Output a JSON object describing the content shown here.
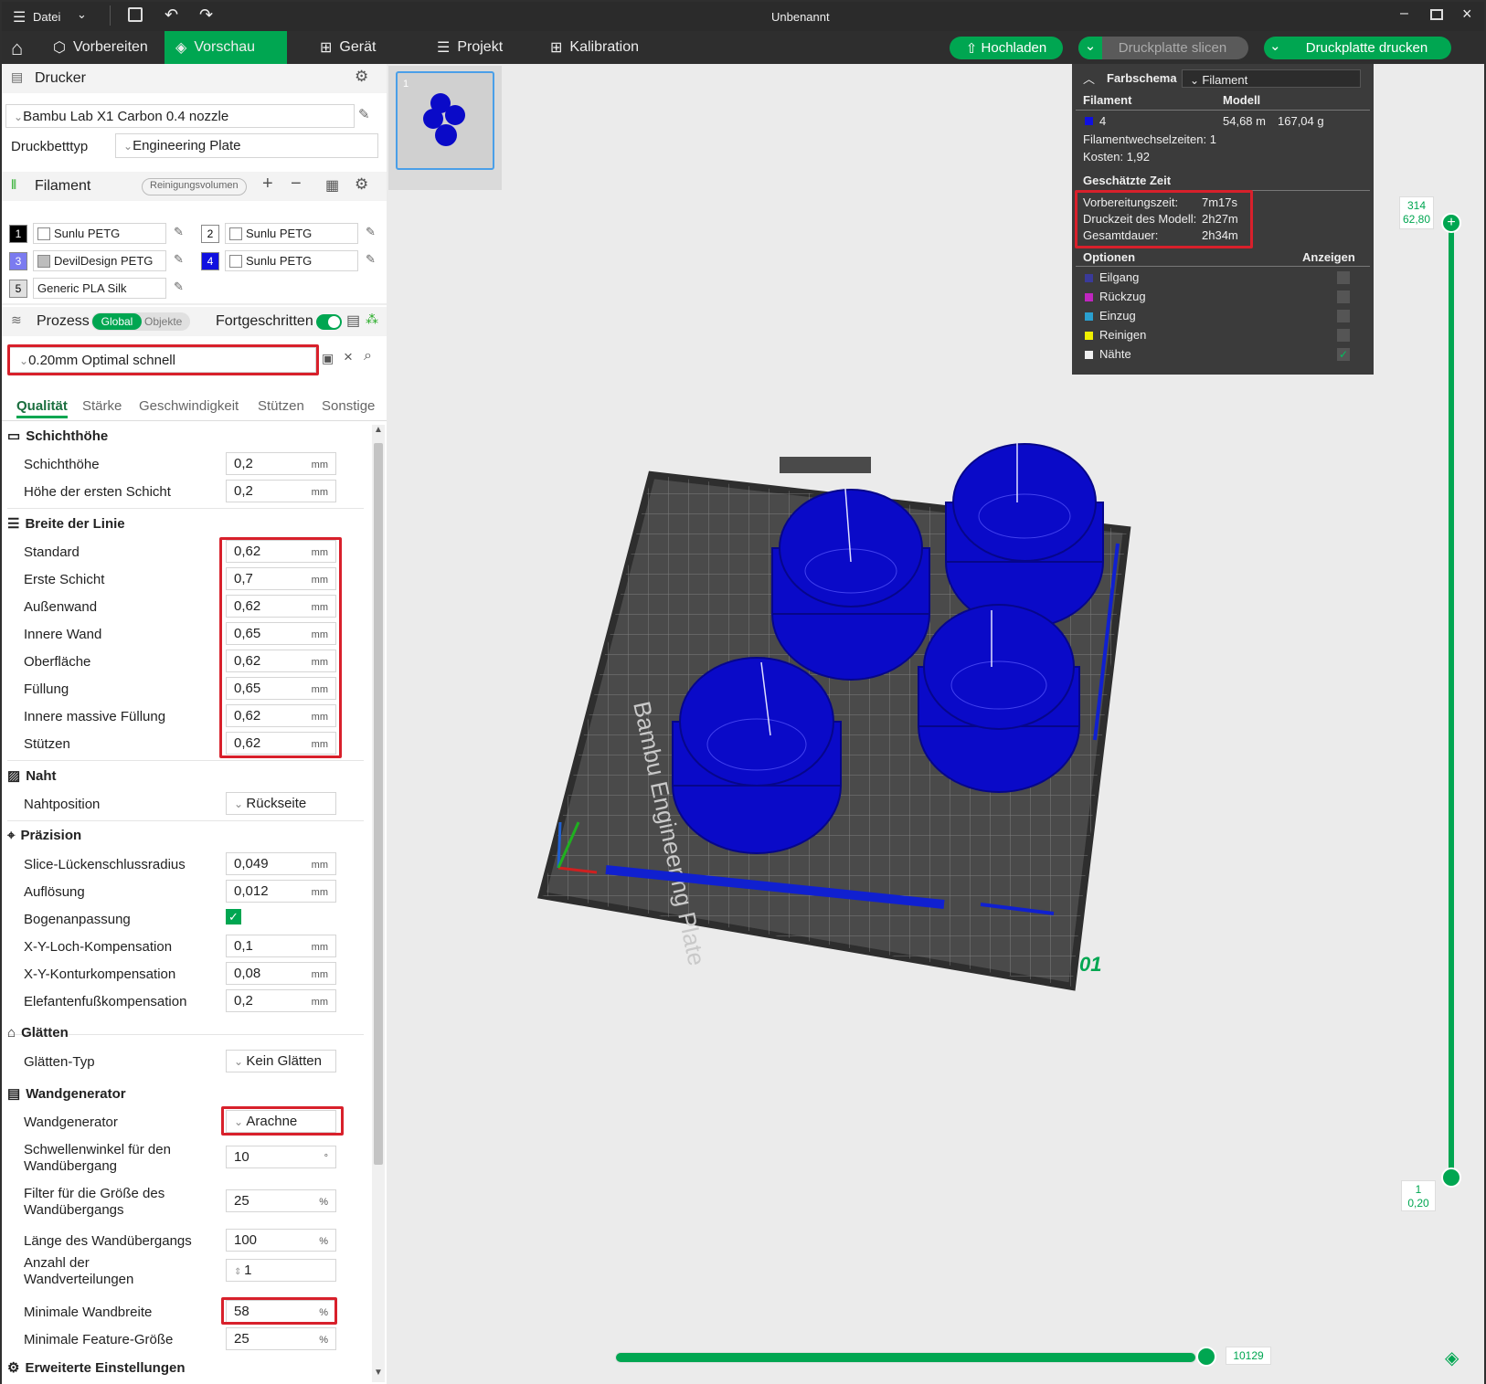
{
  "titlebar": {
    "menu": "Datei",
    "title": "Unbenannt"
  },
  "nav": {
    "tabs": [
      "Vorbereiten",
      "Vorschau",
      "Gerät",
      "Projekt",
      "Kalibration"
    ],
    "upload": "Hochladen",
    "slice": "Druckplatte slicen",
    "print": "Druckplatte drucken"
  },
  "printer": {
    "header": "Drucker",
    "name": "Bambu Lab X1 Carbon 0.4 nozzle",
    "bed_label": "Druckbetttyp",
    "bed_value": "Engineering Plate"
  },
  "filament": {
    "header": "Filament",
    "purge": "Reinigungsvolumen",
    "items": [
      {
        "num": "1",
        "name": "Sunlu PETG",
        "color": "#000000",
        "swatch": "#ffffff"
      },
      {
        "num": "2",
        "name": "Sunlu PETG",
        "color": "#ffffff",
        "swatch": "#ffffff"
      },
      {
        "num": "3",
        "name": "DevilDesign PETG",
        "color": "#7b7bf0",
        "swatch": "#bdbdbd"
      },
      {
        "num": "4",
        "name": "Sunlu PETG",
        "color": "#1010e0",
        "swatch": "#ffffff"
      },
      {
        "num": "5",
        "name": "Generic PLA Silk",
        "color": "#e0e0e0",
        "swatch": ""
      }
    ]
  },
  "process": {
    "header": "Prozess",
    "global": "Global",
    "objects": "Objekte",
    "advanced": "Fortgeschritten",
    "preset": "0.20mm Optimal schnell",
    "tabs": [
      "Qualität",
      "Stärke",
      "Geschwindigkeit",
      "Stützen",
      "Sonstige"
    ]
  },
  "sections": {
    "layer": "Schichthöhe",
    "width": "Breite der Linie",
    "seam": "Naht",
    "precision": "Präzision",
    "ironing": "Glätten",
    "wallgen": "Wandgenerator",
    "advanced": "Erweiterte Einstellungen"
  },
  "params": {
    "layer_height": {
      "label": "Schichthöhe",
      "value": "0,2",
      "unit": "mm"
    },
    "first_layer": {
      "label": "Höhe der ersten Schicht",
      "value": "0,2",
      "unit": "mm"
    },
    "lw_default": {
      "label": "Standard",
      "value": "0,62",
      "unit": "mm"
    },
    "lw_first": {
      "label": "Erste Schicht",
      "value": "0,7",
      "unit": "mm"
    },
    "lw_outer": {
      "label": "Außenwand",
      "value": "0,62",
      "unit": "mm"
    },
    "lw_inner": {
      "label": "Innere Wand",
      "value": "0,65",
      "unit": "mm"
    },
    "lw_top": {
      "label": "Oberfläche",
      "value": "0,62",
      "unit": "mm"
    },
    "lw_infill": {
      "label": "Füllung",
      "value": "0,65",
      "unit": "mm"
    },
    "lw_solid": {
      "label": "Innere massive Füllung",
      "value": "0,62",
      "unit": "mm"
    },
    "lw_support": {
      "label": "Stützen",
      "value": "0,62",
      "unit": "mm"
    },
    "seam_pos": {
      "label": "Nahtposition",
      "value": "Rückseite"
    },
    "gap_close": {
      "label": "Slice-Lückenschlussradius",
      "value": "0,049",
      "unit": "mm"
    },
    "resolution": {
      "label": "Auflösung",
      "value": "0,012",
      "unit": "mm"
    },
    "arc_fit": {
      "label": "Bogenanpassung"
    },
    "xy_hole": {
      "label": "X-Y-Loch-Kompensation",
      "value": "0,1",
      "unit": "mm"
    },
    "xy_contour": {
      "label": "X-Y-Konturkompensation",
      "value": "0,08",
      "unit": "mm"
    },
    "elephant": {
      "label": "Elefantenfußkompensation",
      "value": "0,2",
      "unit": "mm"
    },
    "ironing_type": {
      "label": "Glätten-Typ",
      "value": "Kein Glätten"
    },
    "wall_gen": {
      "label": "Wandgenerator",
      "value": "Arachne"
    },
    "trans_angle": {
      "label1": "Schwellenwinkel für den",
      "label2": "Wandübergang",
      "value": "10",
      "unit": "°"
    },
    "trans_filter": {
      "label1": "Filter für die Größe des",
      "label2": "Wandübergangs",
      "value": "25",
      "unit": "%"
    },
    "trans_len": {
      "label": "Länge des Wandübergangs",
      "value": "100",
      "unit": "%"
    },
    "wall_dist": {
      "label1": "Anzahl der",
      "label2": "Wandverteilungen",
      "value": "1"
    },
    "min_wall": {
      "label": "Minimale Wandbreite",
      "value": "58",
      "unit": "%"
    },
    "min_feature": {
      "label": "Minimale Feature-Größe",
      "value": "25",
      "unit": "%"
    }
  },
  "legend": {
    "title": "Farbschema",
    "scheme": "Filament",
    "col_filament": "Filament",
    "col_model": "Modell",
    "fil_num": "4",
    "fil_len": "54,68 m",
    "fil_weight": "167,04 g",
    "changes": "Filamentwechselzeiten:  1",
    "cost": "Kosten:  1,92",
    "time_header": "Geschätzte Zeit",
    "prep_label": "Vorbereitungszeit:",
    "prep_val": "7m17s",
    "model_label": "Druckzeit des Modell:",
    "model_val": "2h27m",
    "total_label": "Gesamtdauer:",
    "total_val": "2h34m",
    "opt_header": "Optionen",
    "opt_show": "Anzeigen",
    "options": [
      {
        "label": "Eilgang",
        "color": "#3a3a9a"
      },
      {
        "label": "Rückzug",
        "color": "#c026c0"
      },
      {
        "label": "Einzug",
        "color": "#2aa0d0"
      },
      {
        "label": "Reinigen",
        "color": "#f0f000"
      },
      {
        "label": "Nähte",
        "color": "#f0f0f0"
      }
    ]
  },
  "plate": {
    "thumb_num": "1",
    "plate_label": "Bambu Engineering Plate",
    "plate_num": "01"
  },
  "slider": {
    "top_layer": "314",
    "top_height": "62,80",
    "bottom_layer": "1",
    "bottom_height": "0,20",
    "moves": "10129"
  },
  "colors": {
    "accent": "#00a651",
    "model": "#0a0ac8",
    "highlight": "#d8202b"
  }
}
